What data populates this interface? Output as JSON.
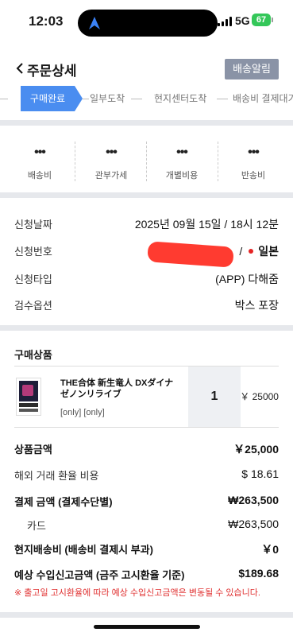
{
  "status_bar": {
    "time": "12:03",
    "network": "5G",
    "battery": "67"
  },
  "header": {
    "title": "주문상세",
    "alert_button": "배송알림"
  },
  "steps": [
    "구매완료",
    "일부도착",
    "현지센터도착",
    "배송비 결제대기"
  ],
  "fees": [
    {
      "value": "•••",
      "label": "배송비"
    },
    {
      "value": "•••",
      "label": "관부가세"
    },
    {
      "value": "•••",
      "label": "개별비용"
    },
    {
      "value": "•••",
      "label": "반송비"
    }
  ],
  "info": {
    "date": {
      "label": "신청날짜",
      "value": "2025년 09월 15일 / 18시 12분"
    },
    "number": {
      "label": "신청번호",
      "suffix": "/",
      "country": "일본"
    },
    "type": {
      "label": "신청타입",
      "value": "(APP) 다해줌"
    },
    "inspection": {
      "label": "검수옵션",
      "value": "박스 포장"
    }
  },
  "products_section": {
    "title": "구매상품",
    "items": [
      {
        "name": "THE合体 新生竜人 DXダイナゼノンリライブ",
        "options": "[only] [only]",
        "quantity": "1",
        "price": "￥ 25000"
      }
    ]
  },
  "totals": {
    "product_amount": {
      "label": "상품금액",
      "value": "￥25,000"
    },
    "overseas_fee": {
      "label": "해외 거래 환율 비용",
      "value": "$ 18.61"
    },
    "payment_amount": {
      "label": "결제 금액 (결제수단별)",
      "value": "₩263,500"
    },
    "card": {
      "label": "카드",
      "value": "₩263,500"
    },
    "local_shipping": {
      "label": "현지배송비 (배송비 결제시 부과)",
      "value": "￥0"
    },
    "import_declaration": {
      "label": "예상 수입신고금액 (금주 고시환율 기준)",
      "value": "$189.68"
    }
  },
  "note": "※ 출고일 고시환율에 따라 예상 수입신고금액은 변동될 수 있습니다.",
  "colors": {
    "accent": "#4a8df0",
    "alert_button": "#8a93a6",
    "warning": "#e03131"
  }
}
